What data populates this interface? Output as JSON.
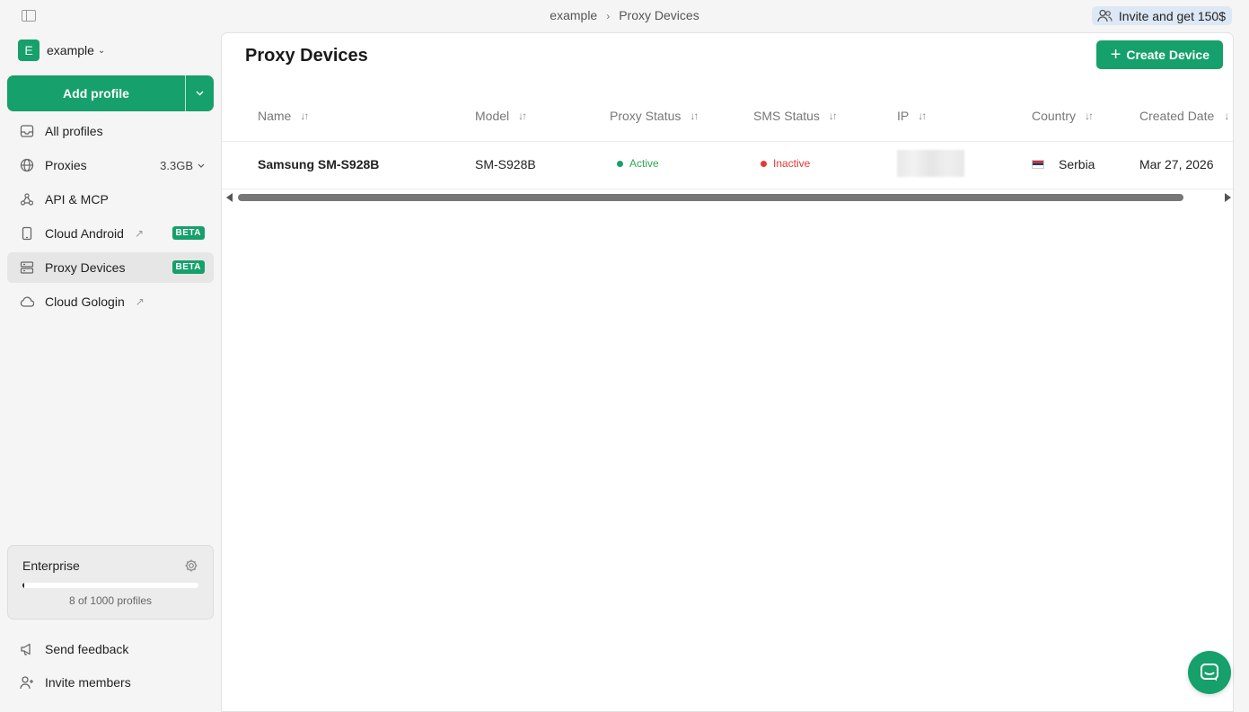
{
  "breadcrumb": {
    "workspace": "example",
    "separator": "›",
    "page": "Proxy Devices"
  },
  "invite": {
    "label": "Invite and get 150$"
  },
  "workspace": {
    "initial": "E",
    "name": "example"
  },
  "add_profile": {
    "label": "Add profile"
  },
  "nav": {
    "all_profiles": "All profiles",
    "proxies": "Proxies",
    "proxies_usage": "3.3GB",
    "api": "API & MCP",
    "cloud_android": "Cloud Android",
    "proxy_devices": "Proxy Devices",
    "cloud_gologin": "Cloud Gologin",
    "beta": "BETA"
  },
  "plan": {
    "name": "Enterprise",
    "used_fraction": 0.008,
    "count_text": "8 of 1000 profiles"
  },
  "bottom": {
    "feedback": "Send feedback",
    "invite_members": "Invite members"
  },
  "main": {
    "title": "Proxy Devices",
    "create_label": "Create Device"
  },
  "table": {
    "headers": {
      "name": "Name",
      "model": "Model",
      "proxy_status": "Proxy Status",
      "sms_status": "SMS Status",
      "ip": "IP",
      "country": "Country",
      "created": "Created Date"
    },
    "rows": [
      {
        "name": "Samsung SM-S928B",
        "model": "SM-S928B",
        "proxy_status": "Active",
        "sms_status": "Inactive",
        "country": "Serbia",
        "created": "Mar 27, 2026"
      }
    ]
  },
  "colors": {
    "accent": "#16a06b",
    "active": "#2fa84f",
    "inactive": "#e53935"
  }
}
